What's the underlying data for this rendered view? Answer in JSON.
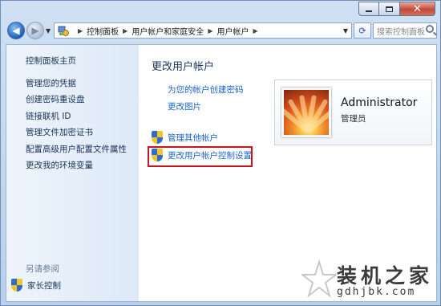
{
  "window": {
    "buttons": {
      "minimize": "",
      "maximize": "",
      "close": "✕"
    }
  },
  "nav": {
    "back_icon": "back-arrow-icon",
    "forward_icon": "forward-arrow-icon",
    "breadcrumb": [
      "控制面板",
      "用户帐户和家庭安全",
      "用户帐户"
    ],
    "search_placeholder": "搜索控制面板"
  },
  "sidebar": {
    "items": [
      {
        "label": "控制面板主页"
      },
      {
        "label": "管理您的凭据"
      },
      {
        "label": "创建密码重设盘"
      },
      {
        "label": "链接联机 ID"
      },
      {
        "label": "管理文件加密证书"
      },
      {
        "label": "配置高级用户配置文件属性"
      },
      {
        "label": "更改我的环境变量"
      }
    ],
    "see_also_title": "另请参阅",
    "see_also_items": [
      {
        "label": "家长控制"
      }
    ]
  },
  "main": {
    "title": "更改用户帐户",
    "links": [
      {
        "label": "为您的帐户创建密码"
      },
      {
        "label": "更改图片"
      }
    ],
    "admin_links": [
      {
        "label": "管理其他帐户"
      },
      {
        "label": "更改用户帐户控制设置"
      }
    ]
  },
  "user": {
    "name": "Administrator",
    "role": "管理员"
  },
  "watermark": {
    "text": "装机之家",
    "url": "gdhjbk.com"
  },
  "colors": {
    "link": "#1d64c6",
    "highlight_box": "#c8151d",
    "sidebar_bg": "#dde9f7"
  }
}
